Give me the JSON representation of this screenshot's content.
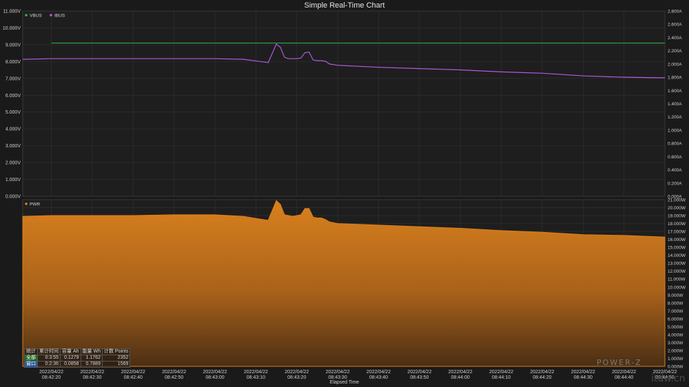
{
  "title": "Simple Real-Time Chart",
  "x_axis_title": "Elapsed Time",
  "logo_text": "POWER-Z",
  "credit_text": "itdw.cn",
  "colors": {
    "vbus": "#2db84a",
    "ibus": "#b15be0",
    "pwr": "#d9801e",
    "background": "#1a1a1a"
  },
  "stats": {
    "headers": [
      "统计",
      "累计时间",
      "容量 Ah",
      "能量 Wh",
      "计数 Points"
    ],
    "rows": [
      [
        "全部",
        "0:3:55",
        "0.1279",
        "1.1762",
        "2352"
      ],
      [
        "窗口",
        "0:2:36",
        "0.0858",
        "0.7889",
        "1569"
      ]
    ]
  },
  "chart_data": [
    {
      "type": "line",
      "panel": "top",
      "legend": [
        "VBUS",
        "IBUS"
      ],
      "legend_placement": "top-left",
      "grid": true,
      "y_left": {
        "ticks": [
          "11.000V",
          "10.000V",
          "9.000V",
          "8.000V",
          "7.000V",
          "6.000V",
          "5.000V",
          "4.000V",
          "3.000V",
          "2.000V",
          "1.000V",
          "0.000V"
        ],
        "ylim": [
          0,
          11
        ]
      },
      "y_right": {
        "ticks": [
          "2.800A",
          "2.600A",
          "2.400A",
          "2.200A",
          "2.000A",
          "1.800A",
          "1.600A",
          "1.400A",
          "1.200A",
          "1.000A",
          "0.800A",
          "0.600A",
          "0.400A",
          "0.200A",
          "0.000A"
        ],
        "ylim": [
          0,
          2.8
        ]
      },
      "series": [
        {
          "name": "VBUS",
          "axis": "left",
          "unit": "V",
          "x": [
            "08:42:20",
            "08:42:30",
            "08:42:40",
            "08:42:50",
            "08:43:00",
            "08:43:10",
            "08:43:20",
            "08:43:30",
            "08:43:40",
            "08:43:50",
            "08:44:00",
            "08:44:10",
            "08:44:20",
            "08:44:30",
            "08:44:40",
            "08:44:50"
          ],
          "values": [
            9.1,
            9.1,
            9.1,
            9.1,
            9.1,
            9.1,
            9.1,
            9.1,
            9.1,
            9.1,
            9.1,
            9.1,
            9.1,
            9.1,
            9.1,
            9.1
          ]
        },
        {
          "name": "IBUS",
          "axis": "right",
          "unit": "A",
          "x": [
            "08:42:13",
            "08:42:20",
            "08:42:30",
            "08:42:40",
            "08:42:50",
            "08:43:00",
            "08:43:07",
            "08:43:13",
            "08:43:15",
            "08:43:16",
            "08:43:17",
            "08:43:18",
            "08:43:19",
            "08:43:20",
            "08:43:21",
            "08:43:22",
            "08:43:23",
            "08:43:24",
            "08:43:25",
            "08:43:26",
            "08:43:27",
            "08:43:28",
            "08:43:30",
            "08:43:40",
            "08:43:50",
            "08:44:00",
            "08:44:10",
            "08:44:20",
            "08:44:30",
            "08:44:40",
            "08:44:50"
          ],
          "values": [
            2.07,
            2.08,
            2.08,
            2.08,
            2.08,
            2.08,
            2.07,
            2.02,
            2.3,
            2.25,
            2.1,
            2.08,
            2.08,
            2.08,
            2.09,
            2.17,
            2.18,
            2.06,
            2.05,
            2.05,
            2.04,
            2.0,
            1.98,
            1.95,
            1.93,
            1.91,
            1.88,
            1.86,
            1.82,
            1.8,
            1.79
          ]
        }
      ]
    },
    {
      "type": "area",
      "panel": "bottom",
      "legend": [
        "PWR"
      ],
      "legend_placement": "top-left",
      "grid": true,
      "y_right": {
        "ticks": [
          "21.000W",
          "20.000W",
          "19.000W",
          "18.000W",
          "17.000W",
          "16.000W",
          "15.000W",
          "14.000W",
          "13.000W",
          "12.000W",
          "11.000W",
          "10.000W",
          "9.000W",
          "8.000W",
          "7.000W",
          "6.000W",
          "5.000W",
          "4.000W",
          "3.000W",
          "2.000W",
          "1.000W",
          "0.000W"
        ],
        "ylim": [
          0,
          21
        ]
      },
      "series": [
        {
          "name": "PWR",
          "unit": "W",
          "x": [
            "08:42:13",
            "08:42:20",
            "08:42:30",
            "08:42:40",
            "08:42:50",
            "08:43:00",
            "08:43:07",
            "08:43:13",
            "08:43:15",
            "08:43:16",
            "08:43:17",
            "08:43:18",
            "08:43:19",
            "08:43:20",
            "08:43:21",
            "08:43:22",
            "08:43:23",
            "08:43:24",
            "08:43:25",
            "08:43:26",
            "08:43:27",
            "08:43:28",
            "08:43:30",
            "08:43:40",
            "08:43:50",
            "08:44:00",
            "08:44:10",
            "08:44:20",
            "08:44:30",
            "08:44:40",
            "08:44:50"
          ],
          "values": [
            18.9,
            19.0,
            19.0,
            19.0,
            19.1,
            19.1,
            18.9,
            18.4,
            20.9,
            20.4,
            19.1,
            19.0,
            18.9,
            19.0,
            19.1,
            19.9,
            19.9,
            18.8,
            18.7,
            18.7,
            18.5,
            18.2,
            18.0,
            17.8,
            17.6,
            17.4,
            17.1,
            16.9,
            16.6,
            16.5,
            16.3
          ]
        }
      ]
    }
  ],
  "x_axis": {
    "ticks": [
      {
        "date": "2022/04/22",
        "time": "08:42:20"
      },
      {
        "date": "2022/04/22",
        "time": "08:42:30"
      },
      {
        "date": "2022/04/22",
        "time": "08:42:40"
      },
      {
        "date": "2022/04/22",
        "time": "08:42:50"
      },
      {
        "date": "2022/04/22",
        "time": "08:43:00"
      },
      {
        "date": "2022/04/22",
        "time": "08:43:10"
      },
      {
        "date": "2022/04/22",
        "time": "08:43:20"
      },
      {
        "date": "2022/04/22",
        "time": "08:43:30"
      },
      {
        "date": "2022/04/22",
        "time": "08:43:40"
      },
      {
        "date": "2022/04/22",
        "time": "08:43:50"
      },
      {
        "date": "2022/04/22",
        "time": "08:44:00"
      },
      {
        "date": "2022/04/22",
        "time": "08:44:10"
      },
      {
        "date": "2022/04/22",
        "time": "08:44:20"
      },
      {
        "date": "2022/04/22",
        "time": "08:44:30"
      },
      {
        "date": "2022/04/22",
        "time": "08:44:40"
      },
      {
        "date": "2022/04/22",
        "time": "08:44:50"
      }
    ],
    "xlim": [
      "08:42:13",
      "08:44:50"
    ]
  }
}
